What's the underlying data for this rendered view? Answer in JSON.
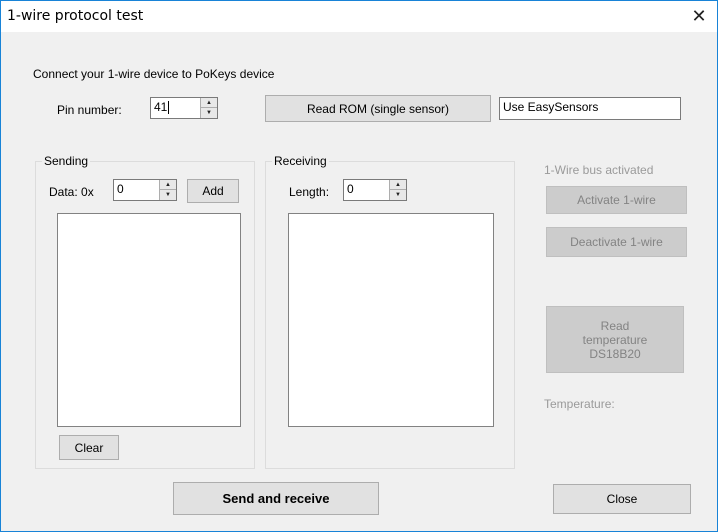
{
  "window": {
    "title": "1-wire protocol test"
  },
  "intro_label": "Connect your 1-wire device to PoKeys device",
  "pin": {
    "label": "Pin number:",
    "value": "41"
  },
  "read_rom_button": "Read ROM (single sensor)",
  "easysensors_field": "Use EasySensors",
  "sending": {
    "group_title": "Sending",
    "data_label": "Data: 0x",
    "data_value": "0",
    "add_button": "Add",
    "clear_button": "Clear"
  },
  "receiving": {
    "group_title": "Receiving",
    "length_label": "Length:",
    "length_value": "0"
  },
  "bus": {
    "status": "1-Wire bus activated",
    "activate_button": "Activate 1-wire",
    "deactivate_button": "Deactivate 1-wire",
    "read_temp_line1": "Read",
    "read_temp_line2": "temperature",
    "read_temp_line3": "DS18B20",
    "temperature_label": "Temperature:"
  },
  "send_receive_button": "Send and receive",
  "close_button": "Close"
}
